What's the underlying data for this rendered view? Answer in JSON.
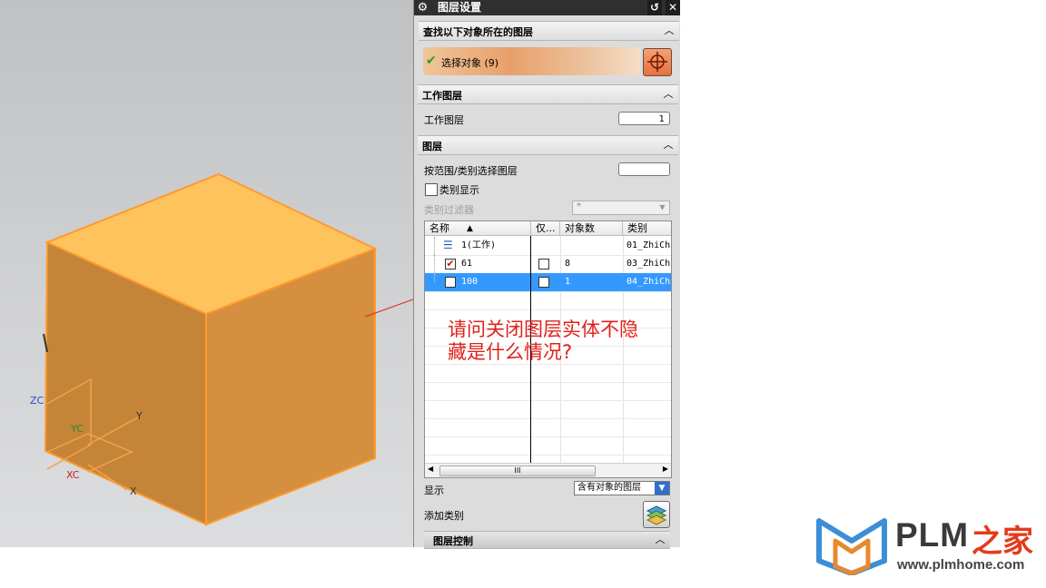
{
  "viewport": {
    "axis_labels": {
      "zc": "ZC",
      "yc": "YC",
      "xc": "XC",
      "y": "Y",
      "x": "X"
    },
    "cube_colors": {
      "top": "#ffc35e",
      "left": "#c48538",
      "right": "#d58f3f",
      "edge": "#ff9a2e"
    }
  },
  "panel": {
    "title": "图层设置",
    "reset_label": "↺",
    "close_label": "✕",
    "sections": {
      "find": {
        "title": "查找以下对象所在的图层",
        "select_label": "选择对象 (9)"
      },
      "work": {
        "title": "工作图层",
        "field_label": "工作图层",
        "field_value": "1"
      },
      "layers": {
        "title": "图层",
        "range_label": "按范围/类别选择图层",
        "range_value": "",
        "category_display_label": "类别显示",
        "category_filter_label": "类别过滤器",
        "category_filter_value": "*",
        "table": {
          "headers": [
            "名称",
            "仅...",
            "对象数",
            "类别"
          ],
          "rows": [
            {
              "name": "1(工作)",
              "only": "",
              "count": "",
              "category": "01_ZhiCh",
              "checked": null,
              "selected": false
            },
            {
              "name": "61",
              "only": "",
              "count": "8",
              "category": "03_ZhiCh",
              "checked": true,
              "selected": false
            },
            {
              "name": "100",
              "only": "",
              "count": "1",
              "category": "04_ZhiCh",
              "checked": false,
              "selected": true
            }
          ],
          "scroll_thumb_label": "III"
        },
        "display_label": "显示",
        "display_value": "含有对象的图层",
        "add_category_label": "添加类别"
      },
      "control": {
        "title": "图层控制"
      }
    }
  },
  "annotation": {
    "text": "请问关闭图层实体不隐\n藏是什么情况?"
  },
  "logo": {
    "plm": "PLM",
    "cn": "之家",
    "url": "www.plmhome.com",
    "color_blue": "#3c8ed6",
    "color_orange": "#e8882e"
  }
}
